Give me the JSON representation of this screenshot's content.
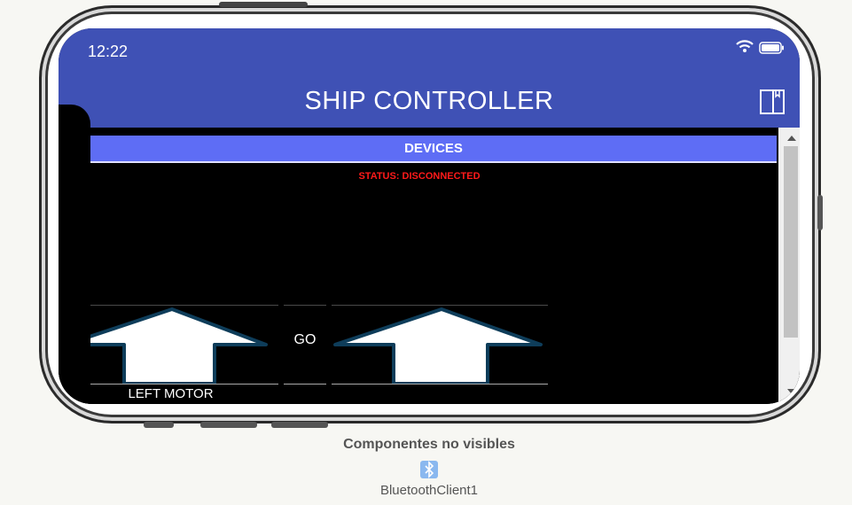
{
  "status_bar": {
    "time": "12:22",
    "wifi_icon": "wifi-icon",
    "battery_icon": "battery-icon"
  },
  "app_bar": {
    "title": "SHIP CONTROLLER",
    "menu_icon": "book-icon",
    "color": "#3f51b5"
  },
  "main": {
    "devices_button": "DEVICES",
    "devices_color": "#5e6df5",
    "status_text": "STATUS: DISCONNECTED",
    "status_color": "#ff1a1a",
    "controls": {
      "left_arrow_icon": "up-arrow-icon",
      "go_label": "GO",
      "right_arrow_icon": "up-arrow-icon",
      "left_motor_label": "LEFT MOTOR"
    }
  },
  "non_visible": {
    "title": "Componentes no visibles",
    "components": [
      {
        "icon": "bluetooth-icon",
        "label": "BluetoothClient1"
      }
    ]
  }
}
